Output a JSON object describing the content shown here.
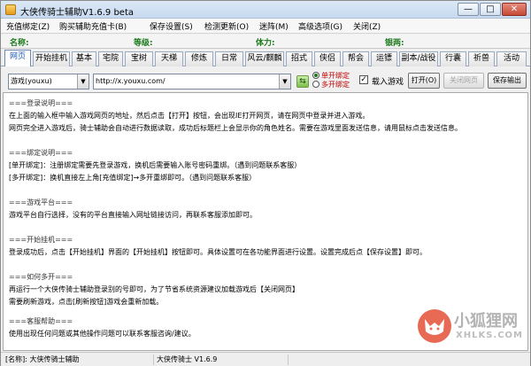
{
  "window": {
    "title": "大侠传骑士辅助V1.6.9 beta",
    "controls": {
      "minimize": "—",
      "maximize": "□",
      "close": "✕"
    }
  },
  "menu": {
    "items": [
      "充值绑定(Z)",
      "购买辅助充值卡(B)",
      "保存设置(S)",
      "检测更新(O)",
      "迷阵(M)",
      "高级选项(G)",
      "关闭(Z)"
    ]
  },
  "stats": {
    "name_label": "名称:",
    "level_label": "等级:",
    "stamina_label": "体力:",
    "gold_label": "银两:"
  },
  "tabs": {
    "items": [
      "网页",
      "开始挂机",
      "基本",
      "宅院",
      "宝树",
      "天梯",
      "修炼",
      "日常",
      "风云/麒麟",
      "招式",
      "侠侣",
      "帮会",
      "运镖",
      "副本/战役",
      "行囊",
      "祈兽",
      "活动"
    ],
    "active": "网页"
  },
  "toolbar": {
    "game_select": "游戏(youxu)",
    "url": "http://x.youxu.com/",
    "radio_single": "单开绑定",
    "radio_multi": "多开绑定",
    "load_game_label": "载入游戏",
    "open_button": "打开(O)",
    "close_page_button": "关闭网页",
    "save_button": "保存输出"
  },
  "content": {
    "lines": [
      "===登录说明===",
      "在上面的输入框中输入游戏网页的地址，然后点击【打开】按钮，会出现IE打开网页，请在网页中登录并进入游戏。",
      "网页完全进入游戏后，骑士辅助会自动进行数据读取，成功后标题栏上会显示你的角色姓名。需要在游戏里面发送信息，请用鼠标点击发送信息。",
      "",
      "===绑定说明===",
      "[单开绑定]：注册绑定需要先登录游戏，换机后需要输入账号密码重绑。（遇到问题联系客服）",
      "[多开绑定]：换机直接左上角[充值绑定]→多开重绑即可。（遇到问题联系客服）",
      "",
      "===游戏平台===",
      "游戏平台自行选择，没有的平台直接输入网址链接访问，再联系客服添加即可。",
      "",
      "===开始挂机===",
      "登录成功后，点击【开始挂机】界面的【开始挂机】按钮即可。具体设置可在各功能界面进行设置。设置完成后点【保存设置】即可。",
      "",
      "===如何多开===",
      "再运行一个大侠传骑士辅助登录别的号即可，为了节省系统资源建议加载游戏后【关闭网页】",
      "需要刷新游戏，点击[刷新按钮]游戏会重新加载。",
      "",
      "===客服帮助===",
      "使用出现任何问题或其他操作问题可以联系客服咨询/建议。"
    ]
  },
  "statusbar": {
    "name_cell": "[名称]: 大侠传骑士辅助",
    "version_cell": "大侠传骑士 V1.6.9"
  },
  "watermark": {
    "title": "小狐狸网",
    "subtitle": "XHLKS.COM"
  },
  "colors": {
    "accent_blue": "#1a56b5",
    "stat_green": "#1d7a1d",
    "radio_red": "#c00000"
  }
}
